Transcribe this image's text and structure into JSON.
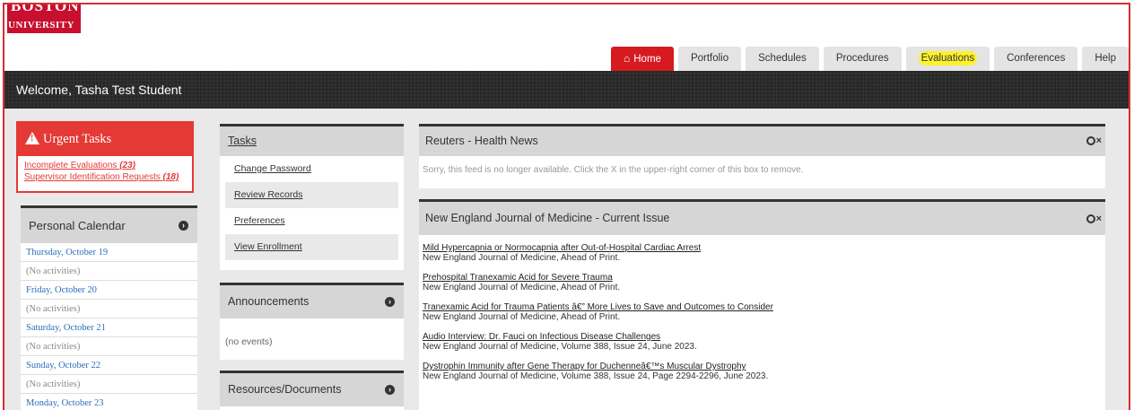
{
  "brand": {
    "line1": "BOSTON",
    "line2": "UNIVERSITY",
    "color": "#c8102e"
  },
  "nav": {
    "tabs": [
      {
        "label": "Home",
        "icon": "home-icon",
        "active": true
      },
      {
        "label": "Portfolio"
      },
      {
        "label": "Schedules"
      },
      {
        "label": "Procedures"
      },
      {
        "label": "Evaluations",
        "highlighted": true
      },
      {
        "label": "Conferences"
      },
      {
        "label": "Help"
      }
    ]
  },
  "welcome": "Welcome, Tasha Test Student",
  "urgent": {
    "title": "Urgent Tasks",
    "items": [
      {
        "label": "Incomplete Evaluations",
        "count": "(23)"
      },
      {
        "label": "Supervisor Identification Requests",
        "count": "(18)"
      }
    ]
  },
  "calendar": {
    "title": "Personal Calendar",
    "days": [
      {
        "date": "Thursday, October 19",
        "note": "(No activities)"
      },
      {
        "date": "Friday, October 20",
        "note": "(No activities)"
      },
      {
        "date": "Saturday, October 21",
        "note": "(No activities)"
      },
      {
        "date": "Sunday, October 22",
        "note": "(No activities)"
      },
      {
        "date": "Monday, October 23",
        "note": ""
      }
    ]
  },
  "tasks": {
    "title": "Tasks",
    "items": [
      "Change Password",
      "Review Records",
      "Preferences",
      "View Enrollment"
    ]
  },
  "announcements": {
    "title": "Announcements",
    "body": "(no events)"
  },
  "resources": {
    "title": "Resources/Documents"
  },
  "reuters": {
    "title": "Reuters - Health News",
    "note": "Sorry, this feed is no longer available. Click the X in the upper-right corner of this box to remove."
  },
  "nejm": {
    "title": "New England Journal of Medicine - Current Issue",
    "articles": [
      {
        "title": "Mild Hypercapnia or Normocapnia after Out-of-Hospital Cardiac Arrest",
        "source": "New England Journal of Medicine, Ahead of Print."
      },
      {
        "title": "Prehospital Tranexamic Acid for Severe Trauma",
        "source": "New England Journal of Medicine, Ahead of Print."
      },
      {
        "title": "Tranexamic Acid for Trauma Patients â€” More Lives to Save and Outcomes to Consider",
        "source": "New England Journal of Medicine, Ahead of Print."
      },
      {
        "title": "Audio Interview: Dr. Fauci on Infectious Disease Challenges",
        "source": "New England Journal of Medicine, Volume 388, Issue 24, June 2023."
      },
      {
        "title": "Dystrophin Immunity after Gene Therapy for Duchenneâ€™s Muscular Dystrophy",
        "source": "New England Journal of Medicine, Volume 388, Issue 24, Page 2294-2296, June 2023."
      }
    ]
  },
  "colors": {
    "accent": "#d71920",
    "urgent": "#e53935",
    "highlight": "#fdf22c",
    "link": "#2a6ebb"
  }
}
